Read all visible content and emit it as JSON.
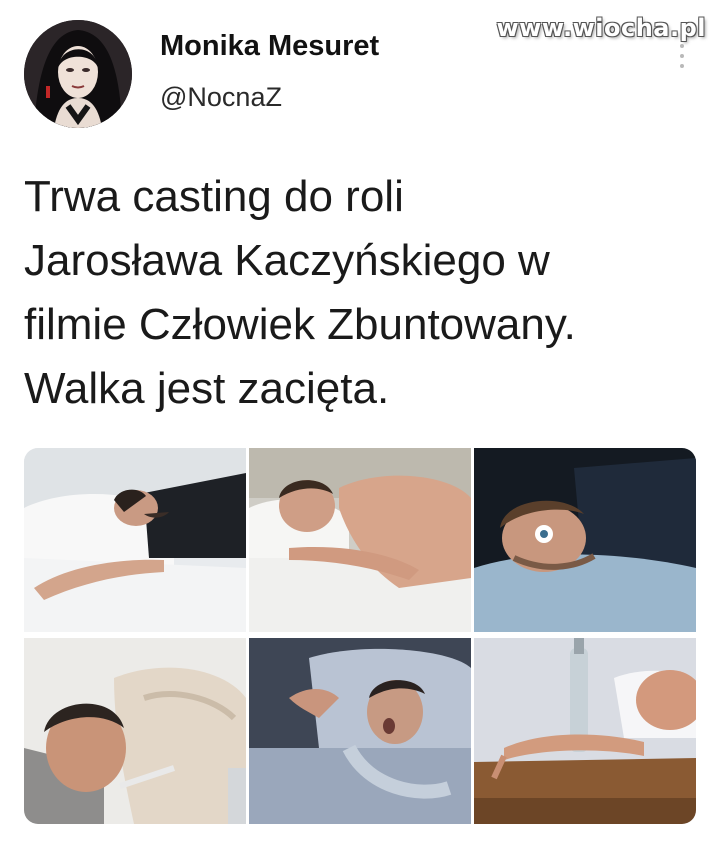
{
  "watermark": "www.wiocha.pl",
  "author": {
    "name": "Monika Mesuret",
    "handle": "@NocnaZ"
  },
  "tweet": {
    "lines": [
      "Trwa casting do roli",
      "Jarosława Kaczyńskiego w",
      "filmie Człowiek Zbuntowany.",
      "Walka jest zacięta."
    ]
  },
  "photos": [
    {
      "subject": "man-snoring-white-bed"
    },
    {
      "subject": "shirtless-man-sleeping"
    },
    {
      "subject": "man-wide-eyed-in-bed"
    },
    {
      "subject": "sick-man-under-blanket"
    },
    {
      "subject": "man-snoring-blue-bedding"
    },
    {
      "subject": "man-passed-out-with-bottle"
    }
  ],
  "colors": {
    "background": "#ffffff",
    "text": "#1a1a1a",
    "more_dots": "#b9b9b9"
  }
}
